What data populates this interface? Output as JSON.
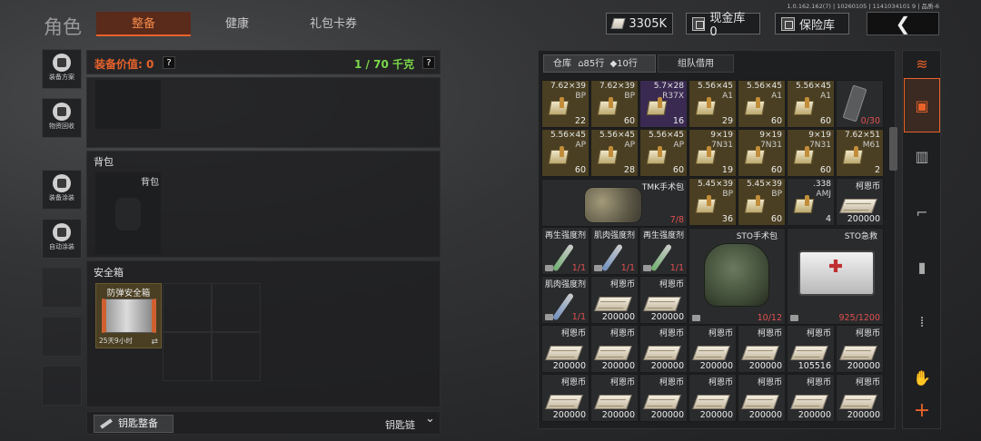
{
  "header": {
    "title": "角色",
    "tabs": [
      {
        "label": "整备"
      },
      {
        "label": "健康"
      },
      {
        "label": "礼包卡券"
      }
    ],
    "version": "1.0.162.162(7) | 10260105 | 1141034101 9 | 品质-6",
    "currency": "3305K",
    "cash_vault": "现金库 0",
    "insurance": "保险库",
    "back": "❮"
  },
  "side": [
    {
      "label": "装备方案",
      "icon": "helmet-icon"
    },
    {
      "label": "物资回收",
      "icon": "recycle-icon"
    },
    {
      "label": "装备涂装",
      "icon": "paint-helmet-icon"
    },
    {
      "label": "自动涂装",
      "icon": "spray-icon"
    }
  ],
  "equip": {
    "value_label": "装备价值: 0",
    "weight": "1 / 70 千克",
    "help": "?"
  },
  "backpack": {
    "title": "背包",
    "slot_label": "背包"
  },
  "safebox": {
    "title": "安全箱",
    "name": "防弹安全箱",
    "timer": "25天9小时",
    "swap": "⇄"
  },
  "keychain": {
    "button": "钥匙整备",
    "label": "钥匙链",
    "chevron": "⌄"
  },
  "inventory": {
    "tab_label": "仓库",
    "rows": "85行",
    "tag_rows": "10行",
    "team_tab": "组队借用",
    "items": [
      {
        "n": "7.62×39",
        "s": "BP",
        "c": "22",
        "k": "gold"
      },
      {
        "n": "7.62×39",
        "s": "BP",
        "c": "60",
        "k": "gold"
      },
      {
        "n": "5.7×28",
        "s": "R37X",
        "c": "16",
        "k": "purple"
      },
      {
        "n": "5.56×45",
        "s": "A1",
        "c": "29",
        "k": "gold"
      },
      {
        "n": "5.56×45",
        "s": "A1",
        "c": "60",
        "k": "gold"
      },
      {
        "n": "5.56×45",
        "s": "A1",
        "c": "60",
        "k": "gold"
      },
      {
        "n": "",
        "s": "",
        "c": "0/30",
        "k": "mag"
      },
      {
        "n": "5.56×45",
        "s": "AP",
        "c": "60",
        "k": "gold"
      },
      {
        "n": "5.56×45",
        "s": "AP",
        "c": "28",
        "k": "gold"
      },
      {
        "n": "5.56×45",
        "s": "AP",
        "c": "60",
        "k": "gold"
      },
      {
        "n": "9×19",
        "s": "7N31",
        "c": "19",
        "k": "gold"
      },
      {
        "n": "9×19",
        "s": "7N31",
        "c": "60",
        "k": "gold"
      },
      {
        "n": "9×19",
        "s": "7N31",
        "c": "60",
        "k": "gold"
      },
      {
        "n": "7.62×51",
        "s": "M61",
        "c": "2",
        "k": "gold"
      },
      {
        "n": "5.45×39",
        "s": "BP",
        "c": "36",
        "k": "gold"
      },
      {
        "n": "5.45×39",
        "s": "BP",
        "c": "60",
        "k": "gold"
      },
      {
        "n": ".338",
        "s": "AMJ",
        "c": "4",
        "k": "blank"
      },
      {
        "n": "柯恩币",
        "s": "",
        "c": "200000",
        "k": "cash"
      },
      {
        "n": "再生强度剂",
        "s": "",
        "c": "1/1",
        "k": "syr"
      },
      {
        "n": "肌肉强度剂",
        "s": "",
        "c": "1/1",
        "k": "syr"
      },
      {
        "n": "再生强度剂",
        "s": "",
        "c": "1/1",
        "k": "syr"
      },
      {
        "n": "肌肉强度剂",
        "s": "",
        "c": "1/1",
        "k": "syr"
      },
      {
        "n": "柯恩币",
        "s": "",
        "c": "200000",
        "k": "cash"
      },
      {
        "n": "柯恩币",
        "s": "",
        "c": "200000",
        "k": "cash"
      },
      {
        "n": "柯恩币",
        "s": "",
        "c": "200000",
        "k": "cash"
      },
      {
        "n": "柯恩币",
        "s": "",
        "c": "200000",
        "k": "cash"
      },
      {
        "n": "柯恩币",
        "s": "",
        "c": "200000",
        "k": "cash"
      },
      {
        "n": "柯恩币",
        "s": "",
        "c": "200000",
        "k": "cash"
      },
      {
        "n": "柯恩币",
        "s": "",
        "c": "200000",
        "k": "cash"
      },
      {
        "n": "柯恩币",
        "s": "",
        "c": "105516",
        "k": "cash"
      },
      {
        "n": "柯恩币",
        "s": "",
        "c": "200000",
        "k": "cash"
      },
      {
        "n": "柯恩币",
        "s": "",
        "c": "200000",
        "k": "cash"
      },
      {
        "n": "柯恩币",
        "s": "",
        "c": "200000",
        "k": "cash"
      },
      {
        "n": "柯恩币",
        "s": "",
        "c": "200000",
        "k": "cash"
      },
      {
        "n": "柯恩币",
        "s": "",
        "c": "200000",
        "k": "cash"
      },
      {
        "n": "柯恩币",
        "s": "",
        "c": "200000",
        "k": "cash"
      },
      {
        "n": "柯恩币",
        "s": "",
        "c": "200000",
        "k": "cash"
      },
      {
        "n": "柯恩币",
        "s": "",
        "c": "200000",
        "k": "cash"
      }
    ],
    "tmk_bag": {
      "name": "TMK手术包",
      "count": "7/8"
    },
    "sto_bag": {
      "name": "STO手术包",
      "count": "10/12"
    },
    "sto_kit": {
      "name": "STO急救",
      "count": "925/1200"
    }
  },
  "rightnav": [
    {
      "icon": "stack-icon"
    },
    {
      "icon": "backpack-icon"
    },
    {
      "icon": "vest-icon"
    },
    {
      "icon": "rifle-icon"
    },
    {
      "icon": "magazine-icon"
    },
    {
      "icon": "bullet-icon"
    },
    {
      "icon": "glove-icon"
    },
    {
      "icon": "plus-icon",
      "label": "+"
    }
  ],
  "colors": {
    "accent": "#e8622a",
    "weight": "#7ad84a",
    "red": "#e05050"
  }
}
